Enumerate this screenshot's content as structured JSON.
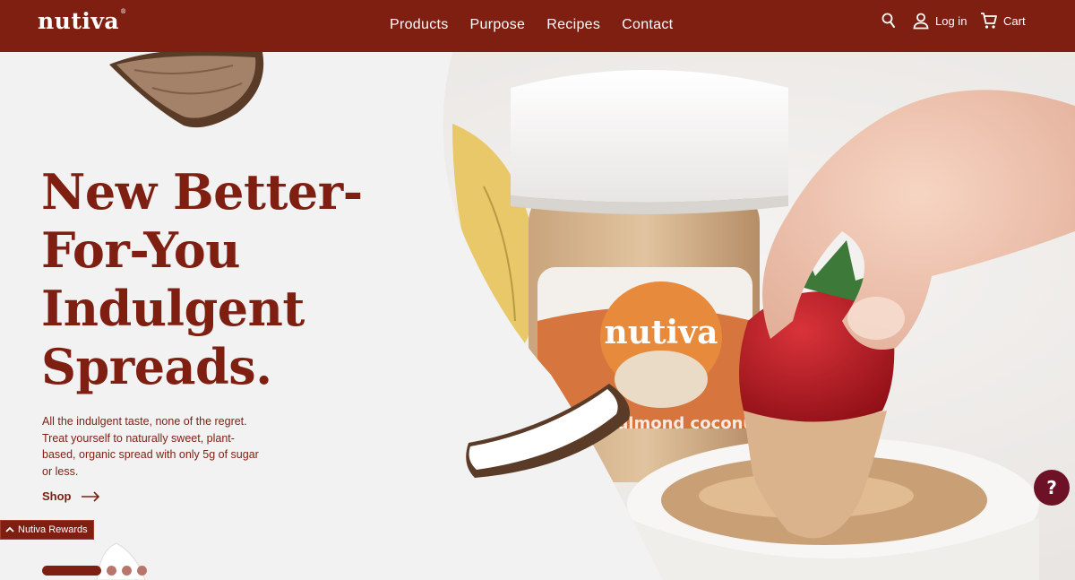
{
  "brand": {
    "logo": "nutiva",
    "trademark": "®"
  },
  "nav": {
    "items": [
      {
        "label": "Products"
      },
      {
        "label": "Purpose"
      },
      {
        "label": "Recipes"
      },
      {
        "label": "Contact"
      }
    ]
  },
  "header_actions": {
    "search_icon": "search-icon",
    "login_label": "Log in",
    "cart_label": "Cart"
  },
  "hero": {
    "headline_lines": [
      "New Better-",
      "For-You",
      "Indulgent",
      "Spreads."
    ],
    "subcopy_lines": [
      "All the indulgent taste, none of the regret.",
      "Treat yourself to naturally sweet, plant-",
      "based, organic spread with only 5g of sugar",
      "or less."
    ],
    "cta_label": "Shop",
    "jar_brand": "nutiva",
    "jar_label": "almond coconut"
  },
  "rewards": {
    "label": "Nutiva Rewards"
  },
  "carousel": {
    "active_index": 0,
    "total": 4
  },
  "help": {
    "label": "?"
  },
  "colors": {
    "brand": "#7e1f12",
    "background": "#f2f2f2",
    "help": "#6d1226"
  }
}
